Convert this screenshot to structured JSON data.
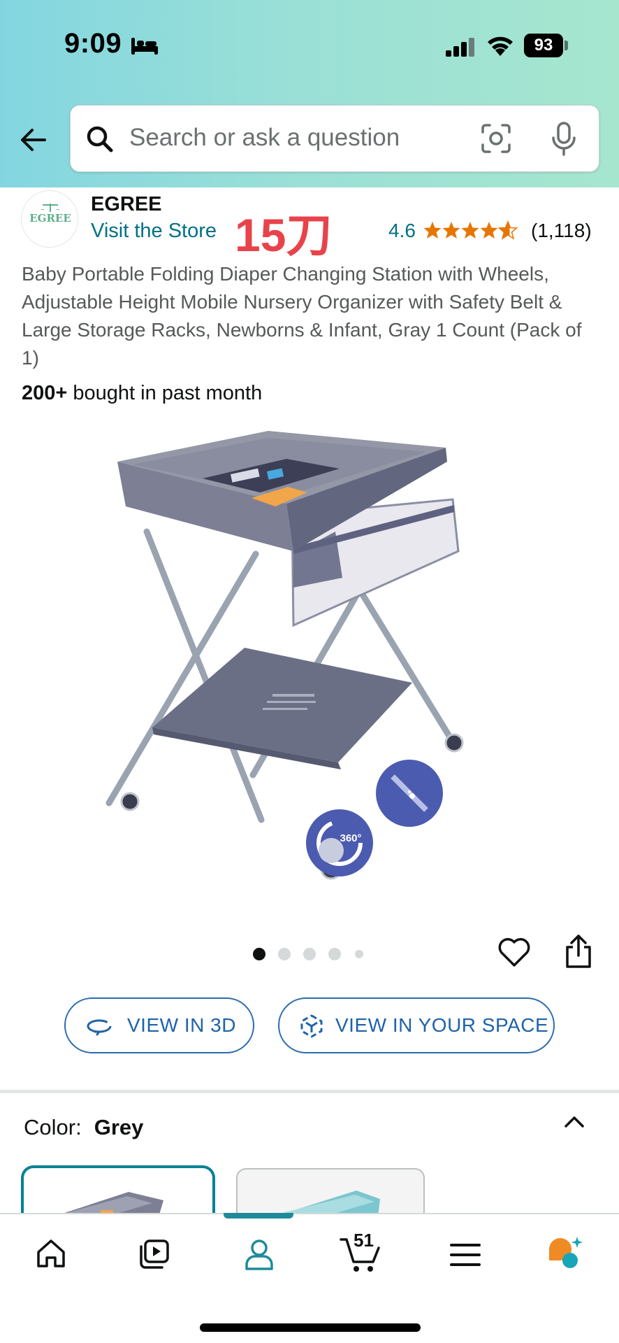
{
  "status_bar": {
    "time": "9:09",
    "battery": "93"
  },
  "search": {
    "placeholder": "Search or ask a question"
  },
  "brand": {
    "logo_text": "EGREE",
    "name": "EGREE",
    "visit_store": "Visit the Store"
  },
  "price_overlay": "15刀",
  "rating": {
    "value": "4.6",
    "stars": 4.6,
    "count": "(1,118)"
  },
  "product": {
    "title": "Baby Portable Folding Diaper Changing Station with Wheels, Adjustable Height Mobile Nursery Organizer with Safety Belt & Large Storage Racks, Newborns & Infant, Gray 1 Count (Pack of 1)",
    "bought_bold": "200+",
    "bought_rest": " bought in past month",
    "badge_360": "360°"
  },
  "carousel": {
    "total_dots": 5,
    "active_index": 0
  },
  "buttons": {
    "view_3d": "VIEW IN 3D",
    "view_space": "VIEW IN YOUR SPACE"
  },
  "color": {
    "label": "Color:",
    "value": "Grey"
  },
  "nav": {
    "cart_count": "51"
  },
  "colors": {
    "link": "#007185",
    "accent_teal": "#008296",
    "button_blue": "#2a6bb0",
    "price_red": "#e8434b",
    "star": "#e77600"
  }
}
